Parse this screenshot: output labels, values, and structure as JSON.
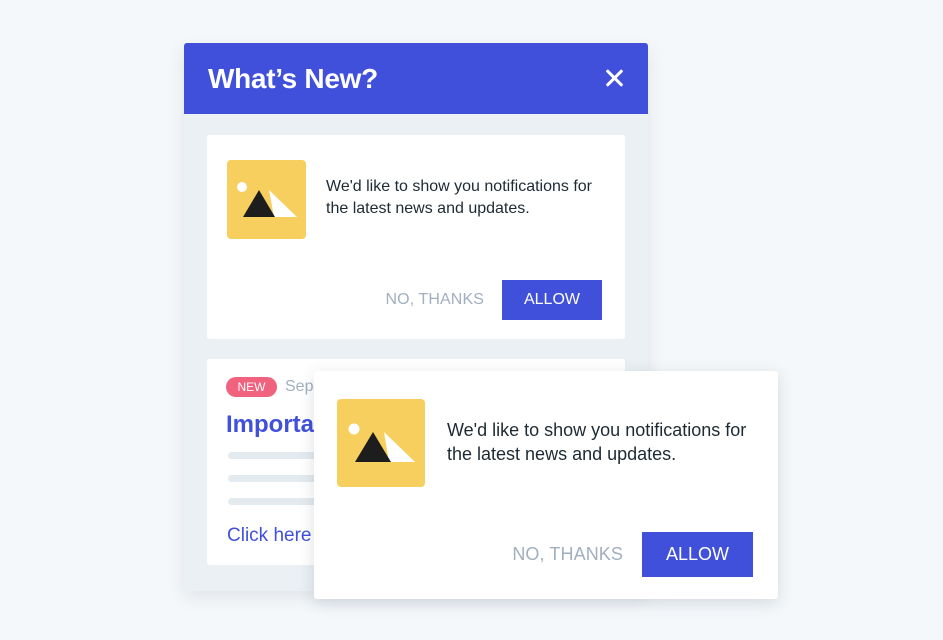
{
  "panel": {
    "title": "What’s New?",
    "close_icon": "close-icon",
    "notification_card": {
      "icon": "image-placeholder-icon",
      "message": "We'd like to show you notifications for the latest news and updates.",
      "no_label": "NO, THANKS",
      "allow_label": "ALLOW"
    },
    "article": {
      "badge": "NEW",
      "date": "Sep",
      "title": "Importa",
      "link": "Click here"
    }
  },
  "popup": {
    "icon": "image-placeholder-icon",
    "message": "We'd like to show you notifications for the latest news and updates.",
    "no_label": "NO, THANKS",
    "allow_label": "ALLOW"
  },
  "colors": {
    "accent": "#4050db",
    "badge": "#f0627e",
    "thumbnail": "#f7cf5f",
    "muted_text": "#a2afbf",
    "background": "#f5f8fa"
  }
}
